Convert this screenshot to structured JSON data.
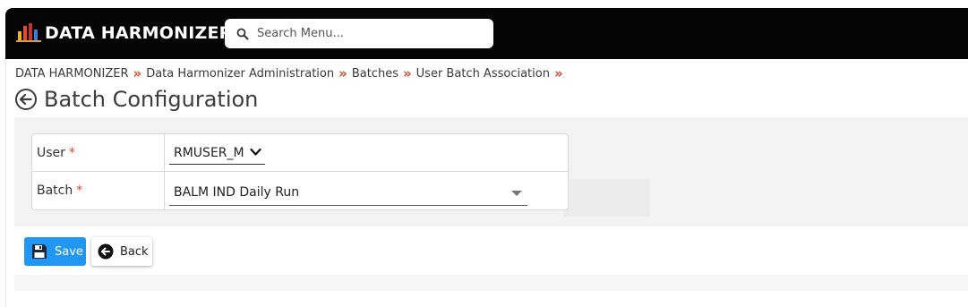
{
  "app": {
    "title": "DATA HARMONIZER",
    "logo_icon": "bar-chart-logo-icon"
  },
  "search": {
    "placeholder": "Search Menu...",
    "value": "",
    "icon": "search-icon"
  },
  "breadcrumb": {
    "items": [
      "DATA HARMONIZER",
      "Data Harmonizer Administration",
      "Batches",
      "User Batch Association"
    ],
    "separator": "»"
  },
  "page": {
    "title": "Batch Configuration",
    "back_icon": "arrow-left-circle-icon"
  },
  "form": {
    "user": {
      "label": "User",
      "required_mark": "*",
      "value": "RMUSER_M"
    },
    "batch": {
      "label": "Batch",
      "required_mark": "*",
      "value": "BALM IND Daily Run"
    }
  },
  "actions": {
    "save_label": "Save",
    "back_label": "Back",
    "save_icon": "floppy-disk-icon",
    "back_icon": "arrow-left-circle-icon"
  },
  "colors": {
    "topbar": "#050505",
    "primary": "#2196f3",
    "required": "#e0413a",
    "breadcrumb_separator": "#d24a2a"
  }
}
